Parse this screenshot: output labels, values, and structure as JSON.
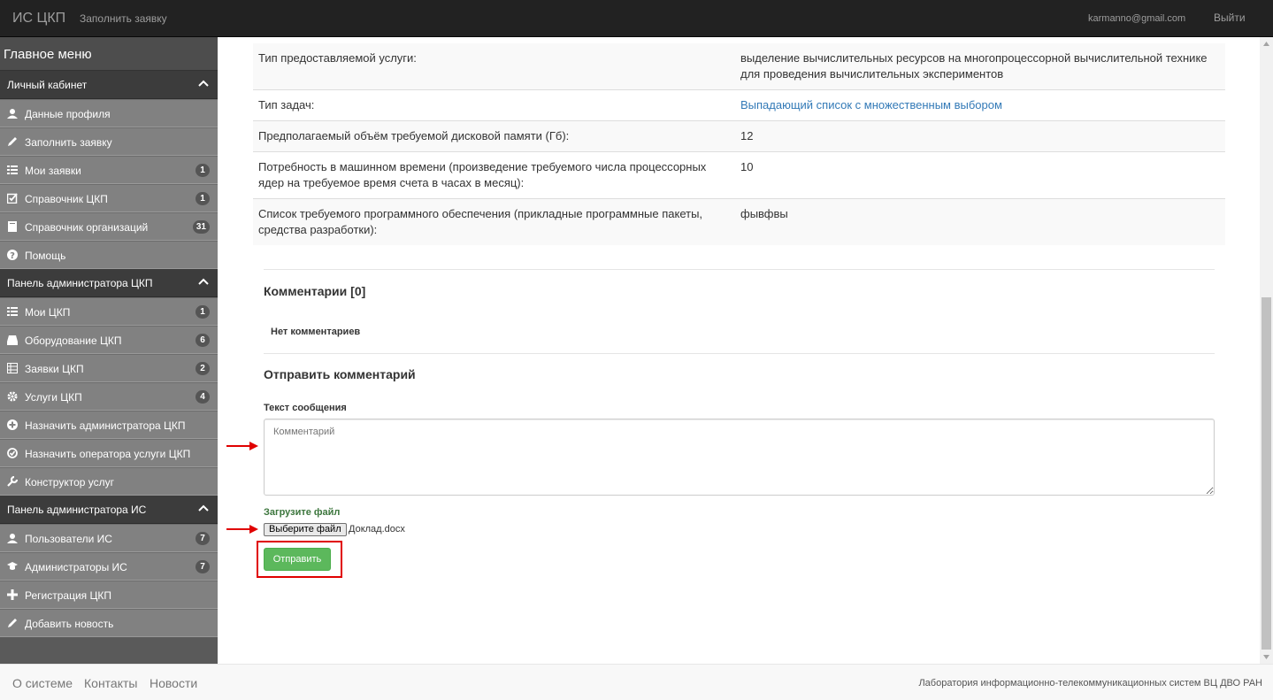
{
  "navbar": {
    "brand": "ИС ЦКП",
    "fill_request": "Заполнить заявку",
    "user_email": "karmanno@gmail.com",
    "logout": "Выйти"
  },
  "sidebar": {
    "title": "Главное меню",
    "sections": [
      {
        "title": "Личный кабинет",
        "items": [
          {
            "label": "Данные профиля",
            "icon": "user-icon",
            "badge": ""
          },
          {
            "label": "Заполнить заявку",
            "icon": "pencil-icon",
            "badge": ""
          },
          {
            "label": "Мои заявки",
            "icon": "list-icon",
            "badge": "1"
          },
          {
            "label": "Справочник ЦКП",
            "icon": "check-square-icon",
            "badge": "1"
          },
          {
            "label": "Справочник организаций",
            "icon": "book-icon",
            "badge": "31"
          },
          {
            "label": "Помощь",
            "icon": "question-icon",
            "badge": ""
          }
        ]
      },
      {
        "title": "Панель администратора ЦКП",
        "items": [
          {
            "label": "Мои ЦКП",
            "icon": "list-icon",
            "badge": "1"
          },
          {
            "label": "Оборудование ЦКП",
            "icon": "hdd-icon",
            "badge": "6"
          },
          {
            "label": "Заявки ЦКП",
            "icon": "table-icon",
            "badge": "2"
          },
          {
            "label": "Услуги ЦКП",
            "icon": "gear-icon",
            "badge": "4"
          },
          {
            "label": "Назначить администратора ЦКП",
            "icon": "plus-circle-icon",
            "badge": ""
          },
          {
            "label": "Назначить оператора услуги ЦКП",
            "icon": "check-circle-icon",
            "badge": ""
          },
          {
            "label": "Конструктор услуг",
            "icon": "wrench-icon",
            "badge": ""
          }
        ]
      },
      {
        "title": "Панель администратора ИС",
        "items": [
          {
            "label": "Пользователи ИС",
            "icon": "user-icon",
            "badge": "7"
          },
          {
            "label": "Администраторы ИС",
            "icon": "graduation-cap-icon",
            "badge": "7"
          },
          {
            "label": "Регистрация ЦКП",
            "icon": "plus-icon",
            "badge": ""
          },
          {
            "label": "Добавить новость",
            "icon": "pencil-icon",
            "badge": ""
          }
        ]
      }
    ]
  },
  "details": [
    {
      "key": "Тип предоставляемой услуги:",
      "value": "выделение вычислительных ресурсов на многопроцессорной вычислительной технике для проведения вычислительных экспериментов",
      "link": false
    },
    {
      "key": "Тип задач:",
      "value": "Выпадающий список с множественным выбором",
      "link": true
    },
    {
      "key": "Предполагаемый объём требуемой дисковой памяти (Гб):",
      "value": "12",
      "link": false
    },
    {
      "key": "Потребность в машинном времени (произведение требуемого числа процессорных ядер на требуемое время счета в часах в месяц):",
      "value": "10",
      "link": false
    },
    {
      "key": "Список требуемого программного обеспечения (прикладные программные пакеты, средства разработки):",
      "value": "фывфвы",
      "link": false
    }
  ],
  "comments": {
    "heading": "Комментарии [0]",
    "empty": "Нет комментариев",
    "send_heading": "Отправить комментарий",
    "message_label": "Текст сообщения",
    "message_placeholder": "Комментарий",
    "file_label": "Загрузите файл",
    "file_button": "Выберите файл",
    "file_name": "Доклад.docx",
    "submit": "Отправить"
  },
  "footer": {
    "about": "О системе",
    "contacts": "Контакты",
    "news": "Новости",
    "credits": "Лаборатория информационно-телекоммуникационных систем ВЦ ДВО РАН"
  },
  "colors": {
    "navbar_bg": "#222222",
    "sidebar_section": "#3c3c3c",
    "sidebar_item": "#818181",
    "submit_green": "#5cb85c",
    "highlight_red": "#e00000",
    "link_blue": "#337ab7"
  }
}
